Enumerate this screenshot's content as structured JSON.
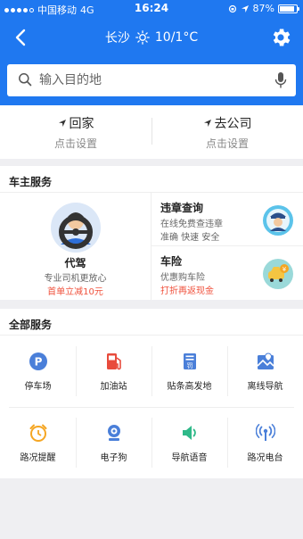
{
  "status": {
    "carrier": "中国移动",
    "network": "4G",
    "time": "16:24",
    "battery": "87%",
    "battery_level": 0.87
  },
  "nav": {
    "city": "长沙",
    "temperature": "10/1°C"
  },
  "search": {
    "placeholder": "输入目的地"
  },
  "quick": {
    "home": {
      "title": "回家",
      "sub": "点击设置"
    },
    "work": {
      "title": "去公司",
      "sub": "点击设置"
    }
  },
  "owner_section": {
    "title": "车主服务",
    "daijia": {
      "name": "代驾",
      "desc": "专业司机更放心",
      "promo": "首单立减10元"
    },
    "violation": {
      "title": "违章查询",
      "line1": "在线免费查违章",
      "line2": "准确 快速 安全"
    },
    "insurance": {
      "title": "车险",
      "line1": "优惠购车险",
      "line2": "打折再返现金"
    }
  },
  "all_section": {
    "title": "全部服务",
    "items": [
      {
        "label": "停车场",
        "icon": "parking-icon"
      },
      {
        "label": "加油站",
        "icon": "fuel-icon"
      },
      {
        "label": "贴条高发地",
        "icon": "ticket-icon"
      },
      {
        "label": "离线导航",
        "icon": "offline-map-icon"
      },
      {
        "label": "路况提醒",
        "icon": "alarm-clock-icon"
      },
      {
        "label": "电子狗",
        "icon": "camera-icon"
      },
      {
        "label": "导航语音",
        "icon": "speaker-icon"
      },
      {
        "label": "路况电台",
        "icon": "radio-icon"
      }
    ]
  },
  "colors": {
    "primary": "#1f78f0",
    "red": "#f0523d",
    "blue_icon": "#4a7fd9",
    "orange_icon": "#f5a623",
    "green_icon": "#2fb989",
    "fuel_red": "#e84b3c"
  }
}
